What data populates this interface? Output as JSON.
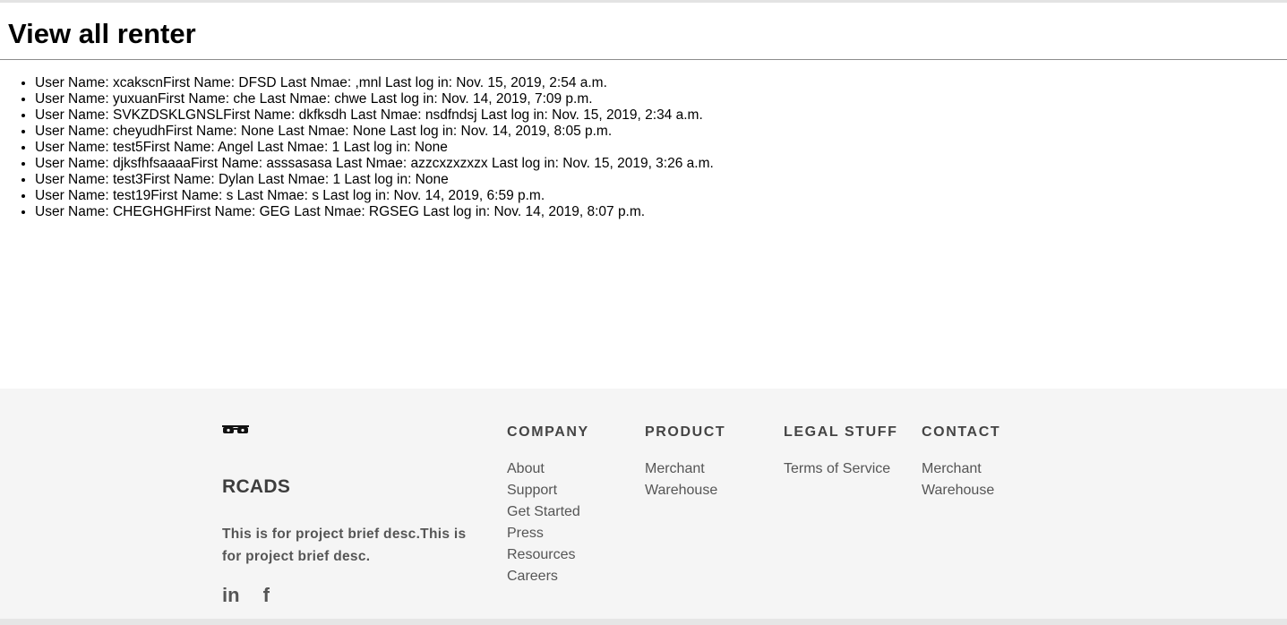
{
  "page": {
    "title": "View all renter"
  },
  "renters": [
    "User Name: xcakscnFirst Name: DFSD Last Nmae: ,mnl Last log in: Nov. 15, 2019, 2:54 a.m.",
    "User Name: yuxuanFirst Name: che Last Nmae: chwe Last log in: Nov. 14, 2019, 7:09 p.m.",
    "User Name: SVKZDSKLGNSLFirst Name: dkfksdh Last Nmae: nsdfndsj Last log in: Nov. 15, 2019, 2:34 a.m.",
    "User Name: cheyudhFirst Name: None Last Nmae: None Last log in: Nov. 14, 2019, 8:05 p.m.",
    "User Name: test5First Name: Angel Last Nmae: 1 Last log in: None",
    "User Name: djksfhfsaaaaFirst Name: asssasasa Last Nmae: azzcxzxzxzx Last log in: Nov. 15, 2019, 3:26 a.m.",
    "User Name: test3First Name: Dylan Last Nmae: 1 Last log in: None",
    "User Name: test19First Name: s Last Nmae: s Last log in: Nov. 14, 2019, 6:59 p.m.",
    "User Name: CHEGHGHFirst Name: GEG Last Nmae: RGSEG Last log in: Nov. 14, 2019, 8:07 p.m."
  ],
  "footer": {
    "brand": {
      "logo_icon": "glasses-logo-icon",
      "name": "RCADS",
      "description": "This is for project brief desc.This is for project brief desc.",
      "social": [
        {
          "icon": "linkedin-icon",
          "glyph": "in"
        },
        {
          "icon": "facebook-icon",
          "glyph": "f"
        }
      ]
    },
    "columns": [
      {
        "heading": "COMPANY",
        "links": [
          "About",
          "Support",
          "Get Started",
          "Press",
          "Resources",
          "Careers"
        ]
      },
      {
        "heading": "PRODUCT",
        "links": [
          "Merchant",
          "Warehouse"
        ]
      },
      {
        "heading": "LEGAL STUFF",
        "links": [
          "Terms of Service"
        ]
      },
      {
        "heading": "CONTACT",
        "links": [
          "Merchant",
          "Warehouse"
        ]
      }
    ]
  },
  "colors": {
    "footer_bg": "#f5f5f5",
    "footer_heading": "#444444",
    "footer_text": "#555555"
  }
}
